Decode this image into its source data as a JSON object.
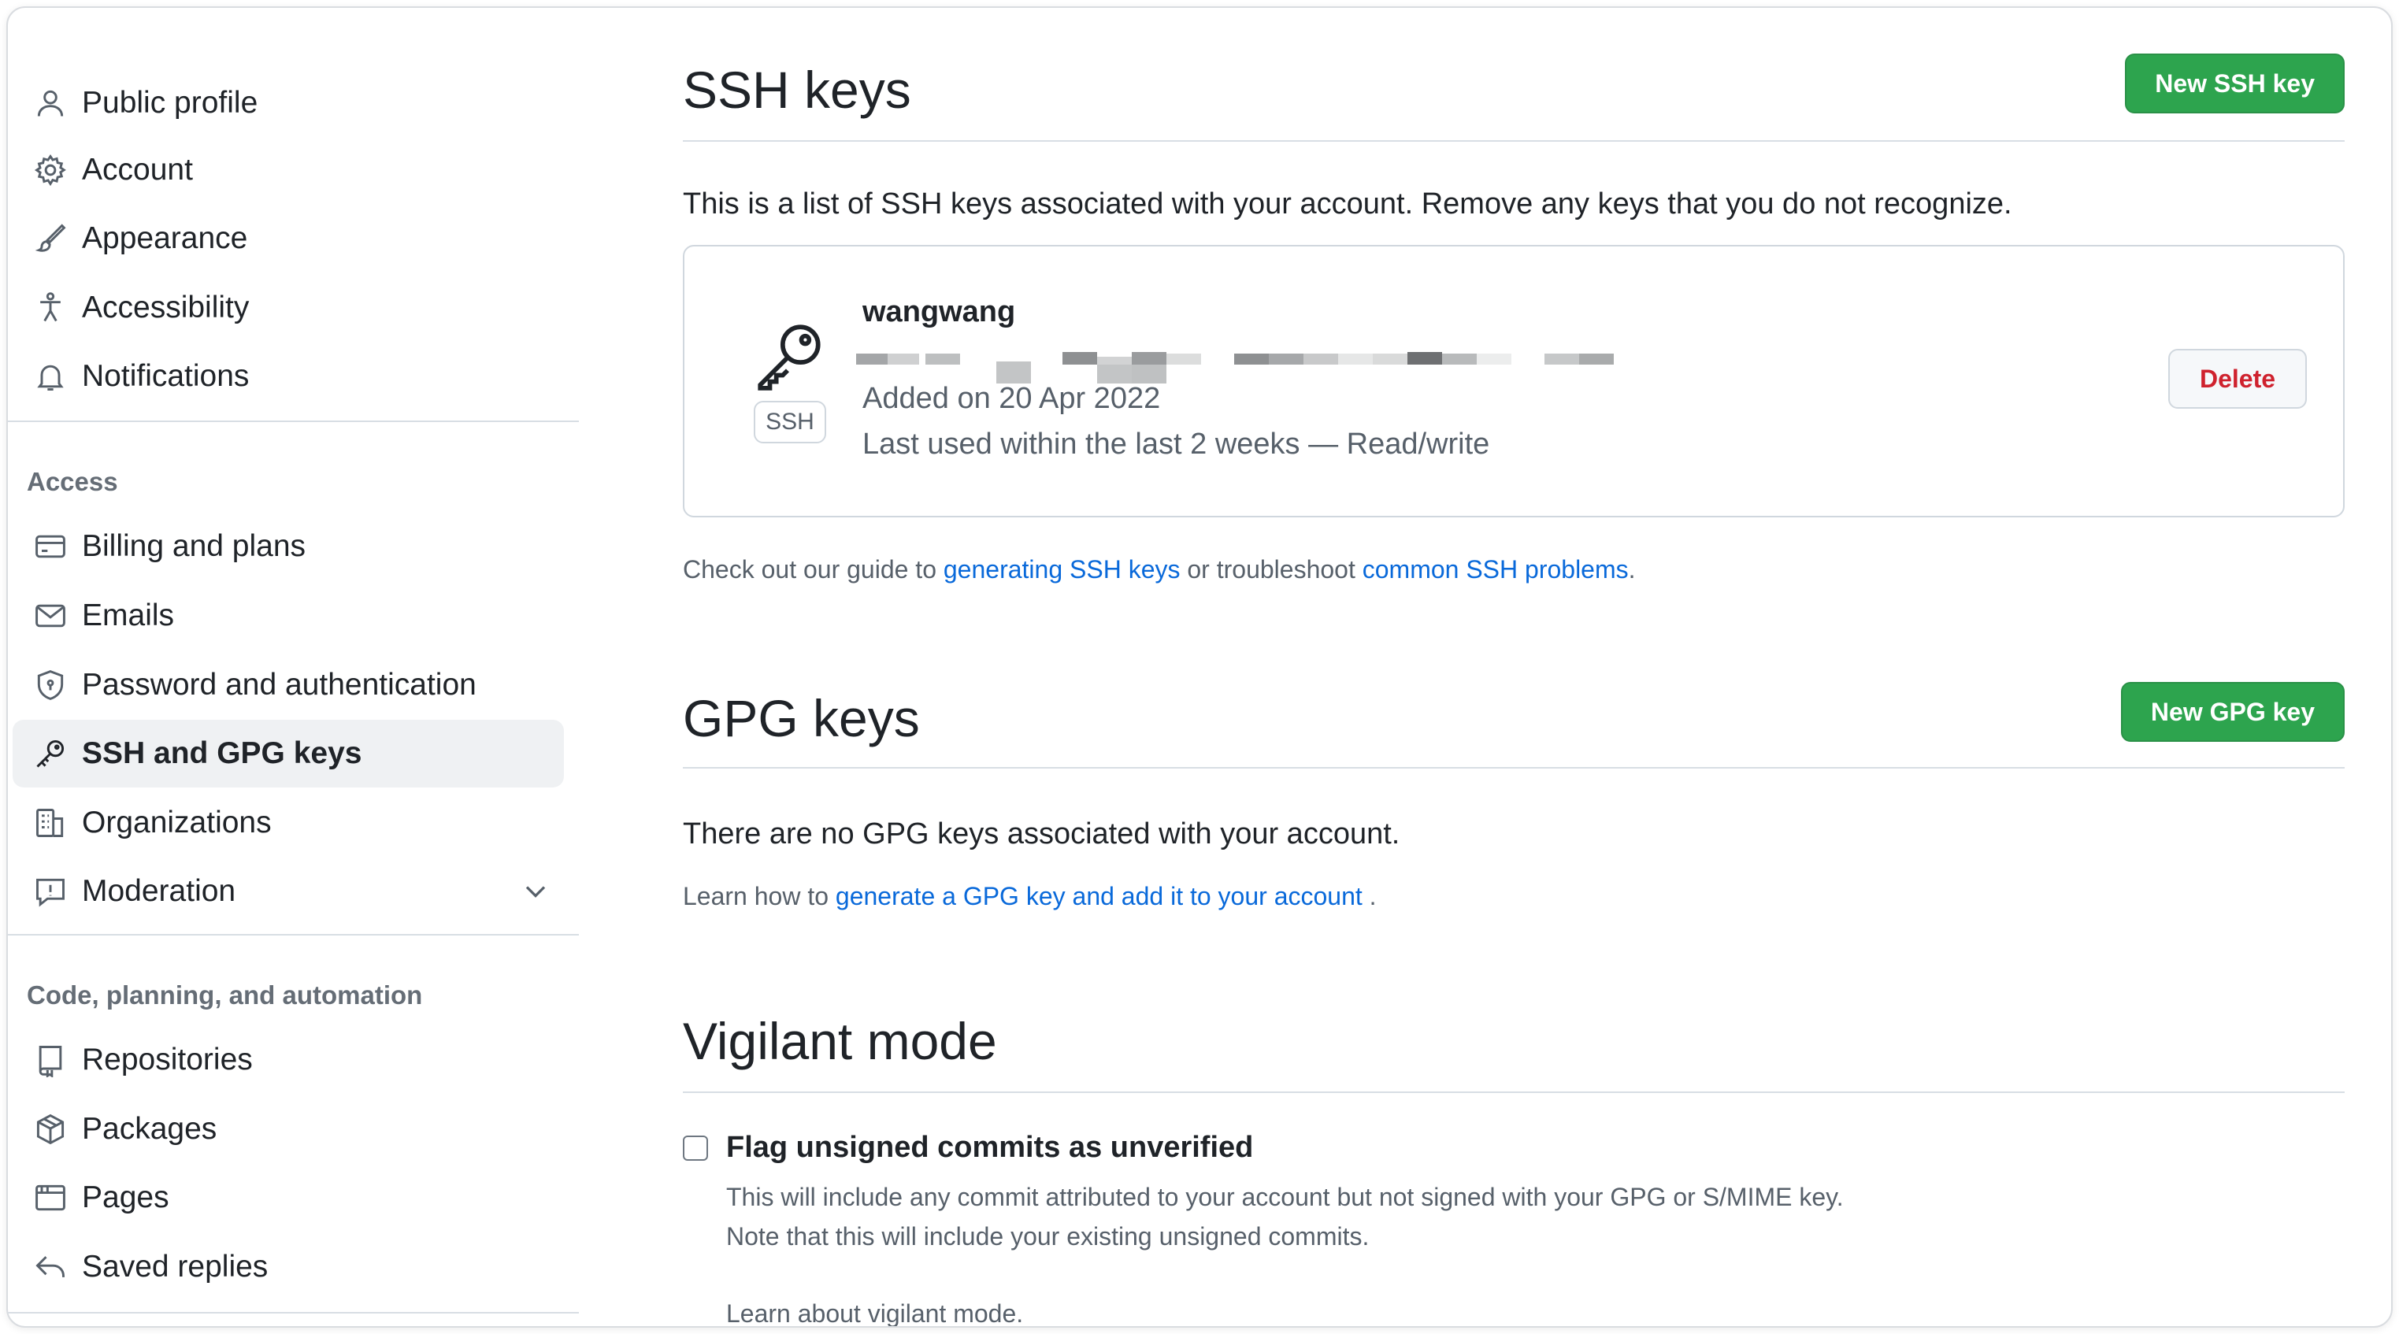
{
  "sidebar": {
    "top_items": [
      {
        "label": "Public profile",
        "icon": "person-icon"
      },
      {
        "label": "Account",
        "icon": "gear-icon"
      },
      {
        "label": "Appearance",
        "icon": "paintbrush-icon"
      },
      {
        "label": "Accessibility",
        "icon": "accessibility-icon"
      },
      {
        "label": "Notifications",
        "icon": "bell-icon"
      }
    ],
    "access_heading": "Access",
    "access_items": [
      {
        "label": "Billing and plans",
        "icon": "credit-card-icon"
      },
      {
        "label": "Emails",
        "icon": "mail-icon"
      },
      {
        "label": "Password and authentication",
        "icon": "shield-lock-icon"
      },
      {
        "label": "SSH and GPG keys",
        "icon": "key-icon",
        "active": true
      },
      {
        "label": "Organizations",
        "icon": "organization-icon"
      },
      {
        "label": "Moderation",
        "icon": "report-icon"
      }
    ],
    "code_heading": "Code, planning, and automation",
    "code_items": [
      {
        "label": "Repositories",
        "icon": "repo-icon"
      },
      {
        "label": "Packages",
        "icon": "package-icon"
      },
      {
        "label": "Pages",
        "icon": "browser-icon"
      },
      {
        "label": "Saved replies",
        "icon": "reply-icon"
      }
    ]
  },
  "ssh": {
    "title": "SSH keys",
    "new_button": "New SSH key",
    "description": "This is a list of SSH keys associated with your account. Remove any keys that you do not recognize.",
    "key": {
      "badge": "SSH",
      "name": "wangwang",
      "added": "Added on 20 Apr 2022",
      "last_used": "Last used within the last 2 weeks — Read/write",
      "delete_button": "Delete"
    },
    "guide_prefix": "Check out our guide to ",
    "guide_link1": "generating SSH keys",
    "guide_middle": " or troubleshoot ",
    "guide_link2": "common SSH problems",
    "guide_suffix": "."
  },
  "gpg": {
    "title": "GPG keys",
    "new_button": "New GPG key",
    "empty_text": "There are no GPG keys associated with your account.",
    "learn_prefix": "Learn how to ",
    "learn_link": "generate a GPG key and add it to your account",
    "learn_suffix": " ."
  },
  "vigilant": {
    "title": "Vigilant mode",
    "checkbox_label": "Flag unsigned commits as unverified",
    "checked": false,
    "desc1": "This will include any commit attributed to your account but not signed with your GPG or S/MIME key.",
    "desc2": "Note that this will include your existing unsigned commits.",
    "learn_link": "Learn about vigilant mode."
  },
  "colors": {
    "primary_button": "#2da44e",
    "link": "#0969da",
    "danger": "#cf222e",
    "active_nav_bg": "#eff1f3"
  }
}
